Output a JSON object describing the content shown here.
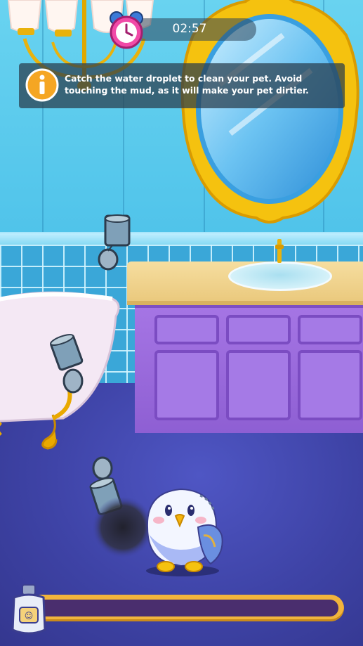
{
  "hud": {
    "timer": "02:57",
    "clock_icon": "alarm-clock-icon",
    "info_icon": "info-icon",
    "instruction": "Catch the water droplet to clean your pet. Avoid touching the mud, as it will make your pet dirtier."
  },
  "progress": {
    "clean_fraction": 0,
    "icon": "shampoo-bottle-icon"
  },
  "scene": {
    "pet": "budgie-bird",
    "falling_items": [
      "paint-can-icon",
      "paint-can-icon",
      "paint-can-icon"
    ],
    "mud": "mud-splat"
  },
  "colors": {
    "wall": "#4fc3ea",
    "floor": "#3e43a6",
    "cabinet": "#9b6adb",
    "frame_gold": "#f5c20f",
    "progress_track": "#f2b43c",
    "progress_fill": "#7ee07a"
  }
}
